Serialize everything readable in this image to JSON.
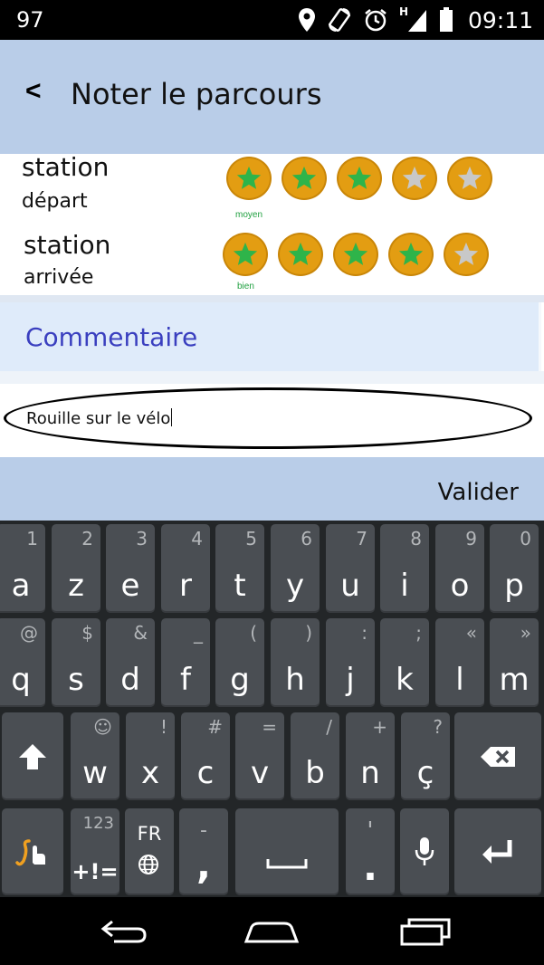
{
  "status_bar": {
    "left_text": "97",
    "time": "09:11",
    "network_label": "H",
    "icons": [
      "location-icon",
      "screen-rotation-icon",
      "alarm-icon",
      "signal-icon",
      "battery-icon"
    ]
  },
  "header": {
    "back_label": "<",
    "title": "Noter le parcours"
  },
  "ratings": [
    {
      "label_line1": "station",
      "label_line2": "départ",
      "rating_text": "moyen",
      "stars_filled": 3,
      "stars_total": 5
    },
    {
      "label_line1": "station",
      "label_line2": "arrivée",
      "rating_text": "bien",
      "stars_filled": 4,
      "stars_total": 5
    }
  ],
  "comment": {
    "label": "Commentaire",
    "value": "Rouille sur le vélo"
  },
  "validate_label": "Valider",
  "keyboard": {
    "row1": [
      {
        "main": "a",
        "hint": "1"
      },
      {
        "main": "z",
        "hint": "2"
      },
      {
        "main": "e",
        "hint": "3"
      },
      {
        "main": "r",
        "hint": "4"
      },
      {
        "main": "t",
        "hint": "5"
      },
      {
        "main": "y",
        "hint": "6"
      },
      {
        "main": "u",
        "hint": "7"
      },
      {
        "main": "i",
        "hint": "8"
      },
      {
        "main": "o",
        "hint": "9"
      },
      {
        "main": "p",
        "hint": "0"
      }
    ],
    "row2": [
      {
        "main": "q",
        "hint": "@"
      },
      {
        "main": "s",
        "hint": "$"
      },
      {
        "main": "d",
        "hint": "&"
      },
      {
        "main": "f",
        "hint": "_"
      },
      {
        "main": "g",
        "hint": "("
      },
      {
        "main": "h",
        "hint": ")"
      },
      {
        "main": "j",
        "hint": ":"
      },
      {
        "main": "k",
        "hint": ";"
      },
      {
        "main": "l",
        "hint": "«"
      },
      {
        "main": "m",
        "hint": "»"
      }
    ],
    "row3": [
      {
        "main": "w",
        "hint": "☺"
      },
      {
        "main": "x",
        "hint": "!"
      },
      {
        "main": "c",
        "hint": "#"
      },
      {
        "main": "v",
        "hint": "="
      },
      {
        "main": "b",
        "hint": "/"
      },
      {
        "main": "n",
        "hint": "+"
      },
      {
        "main": "ç",
        "hint": "?"
      }
    ],
    "symbols_hint": "123",
    "symbols_label": "+!=",
    "language_label": "FR",
    "comma_hint": "-",
    "comma_label": ",",
    "period_hint": "'",
    "period_label": "."
  },
  "colors": {
    "header_bg": "#b9cde8",
    "star_filled": "#2eb44a",
    "star_empty": "#c8c8c8",
    "star_coin": "#e39d12",
    "comment_label": "#3a3fbf",
    "keyboard_bg": "#232628",
    "key_bg": "#4a4e53"
  }
}
